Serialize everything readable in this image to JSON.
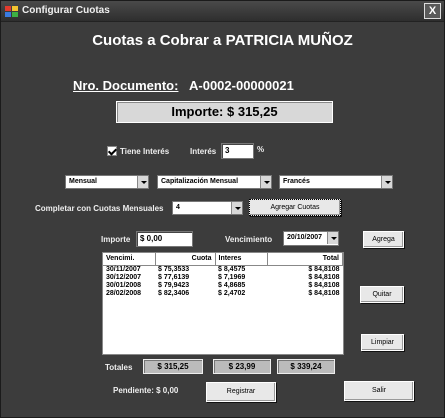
{
  "window": {
    "title": "Configurar Cuotas",
    "close_label": "X"
  },
  "heading": "Cuotas a Cobrar a PATRICIA MUÑOZ",
  "documento": {
    "label": "Nro. Documento:",
    "value": "A-0002-00000021"
  },
  "importe_total": "Importe: $ 315,25",
  "interes": {
    "checkbox_label": "Tiene Interés",
    "checked": true,
    "label": "Interés",
    "value": "3",
    "unit": "%"
  },
  "combos": {
    "periodo": "Mensual",
    "capitalizacion": "Capitalización Mensual",
    "sistema": "Francés"
  },
  "completar": {
    "label": "Completar con Cuotas Mensuales",
    "value": "4",
    "button": "Agregar Cuotas"
  },
  "nueva_cuota": {
    "importe_label": "Importe",
    "importe_value": "$ 0,00",
    "vencimiento_label": "Vencimiento",
    "vencimiento_value": "20/10/2007",
    "agregar_button": "Agrega"
  },
  "grid": {
    "columns": [
      "Vencimi.",
      "Cuota",
      "Interes",
      "Total"
    ],
    "rows": [
      [
        "30/11/2007",
        "$ 75,3533",
        "$ 8,4575",
        "$ 84,8108"
      ],
      [
        "30/12/2007",
        "$ 77,6139",
        "$ 7,1969",
        "$ 84,8108"
      ],
      [
        "30/01/2008",
        "$ 79,9423",
        "$ 4,8685",
        "$ 84,8108"
      ],
      [
        "28/02/2008",
        "$ 82,3406",
        "$ 2,4702",
        "$ 84,8108"
      ]
    ]
  },
  "side_buttons": {
    "quitar": "Quitar",
    "limpiar": "Limpiar"
  },
  "totales": {
    "label": "Totales",
    "cuota": "$ 315,25",
    "interes": "$ 23,99",
    "total": "$ 339,24"
  },
  "pendiente": "Pendiente: $ 0,00",
  "buttons": {
    "registrar": "Registrar",
    "salir": "Salir"
  }
}
